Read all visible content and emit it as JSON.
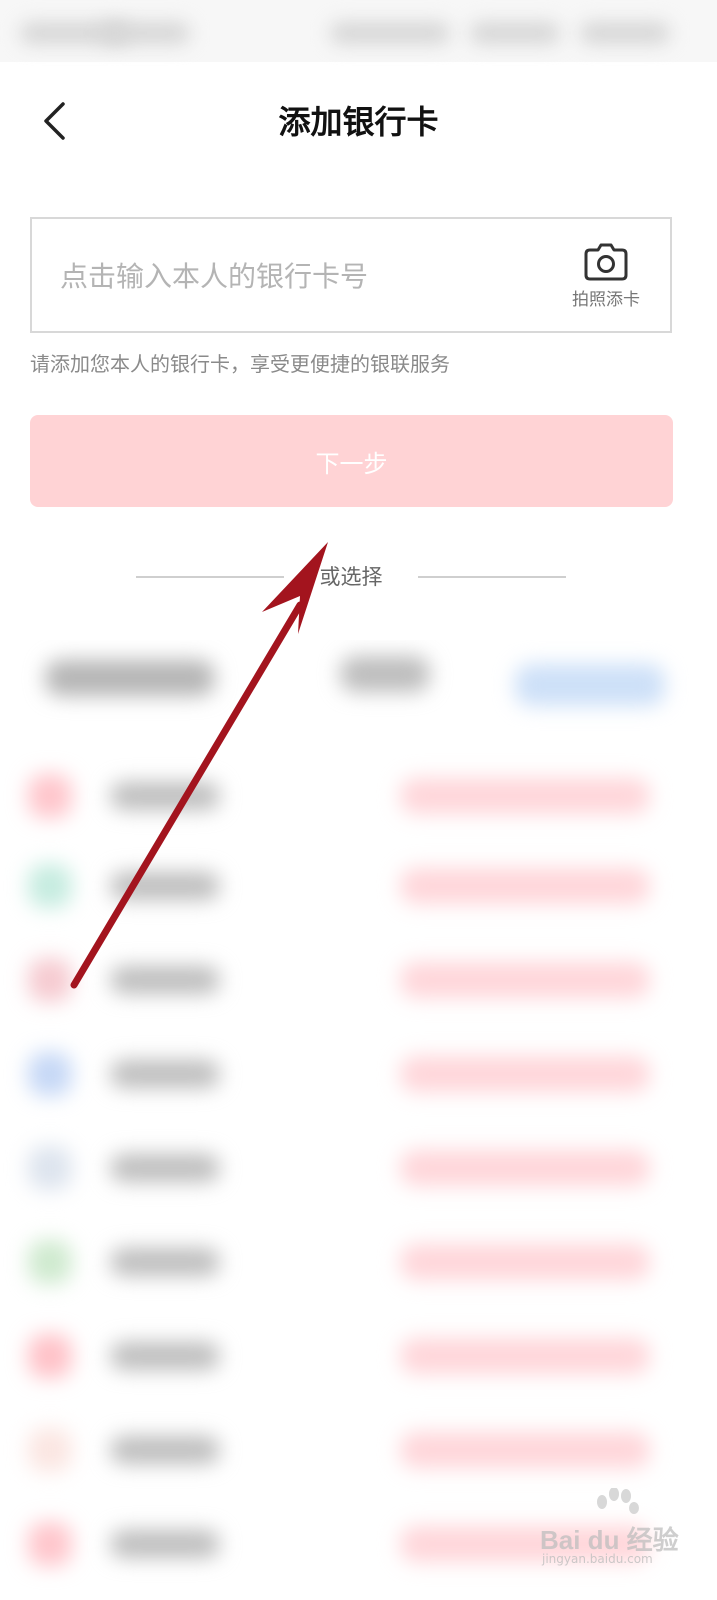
{
  "header": {
    "title": "添加银行卡",
    "back_icon": "chevron-left-icon"
  },
  "card_input": {
    "placeholder": "点击输入本人的银行卡号",
    "value": "",
    "photo_label": "拍照添卡",
    "photo_icon": "camera-icon"
  },
  "hint": "请添加您本人的银行卡，享受更便捷的银联服务",
  "next_button": {
    "label": "下一步",
    "color": "#ffd3d5"
  },
  "divider": {
    "label": "或选择"
  },
  "annotation": {
    "arrow_color": "#a3141e"
  },
  "watermark": {
    "brand": "Bai du 经验",
    "url": "jingyan.baidu.com"
  }
}
